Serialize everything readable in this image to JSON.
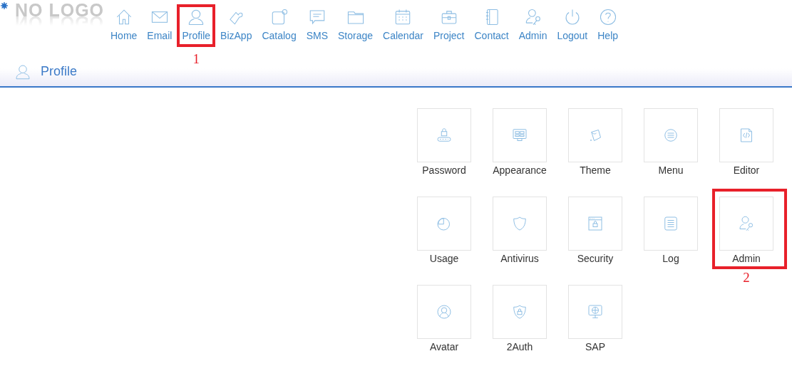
{
  "logo": {
    "text": "NO LOGO"
  },
  "nav": [
    {
      "label": "Home",
      "highlighted": false
    },
    {
      "label": "Email",
      "highlighted": false
    },
    {
      "label": "Profile",
      "highlighted": true,
      "callout": "1"
    },
    {
      "label": "BizApp",
      "highlighted": false
    },
    {
      "label": "Catalog",
      "highlighted": false
    },
    {
      "label": "SMS",
      "highlighted": false
    },
    {
      "label": "Storage",
      "highlighted": false
    },
    {
      "label": "Calendar",
      "highlighted": false
    },
    {
      "label": "Project",
      "highlighted": false
    },
    {
      "label": "Contact",
      "highlighted": false
    },
    {
      "label": "Admin",
      "highlighted": false
    },
    {
      "label": "Logout",
      "highlighted": false
    },
    {
      "label": "Help",
      "highlighted": false
    }
  ],
  "page_header": {
    "title": "Profile"
  },
  "tiles": [
    {
      "label": "Password",
      "highlighted": false
    },
    {
      "label": "Appearance",
      "highlighted": false
    },
    {
      "label": "Theme",
      "highlighted": false
    },
    {
      "label": "Menu",
      "highlighted": false
    },
    {
      "label": "Editor",
      "highlighted": false
    },
    {
      "label": "Usage",
      "highlighted": false
    },
    {
      "label": "Antivirus",
      "highlighted": false
    },
    {
      "label": "Security",
      "highlighted": false
    },
    {
      "label": "Log",
      "highlighted": false
    },
    {
      "label": "Admin",
      "highlighted": true,
      "callout": "2"
    },
    {
      "label": "Avatar",
      "highlighted": false
    },
    {
      "label": "2Auth",
      "highlighted": false
    },
    {
      "label": "SAP",
      "highlighted": false
    }
  ]
}
